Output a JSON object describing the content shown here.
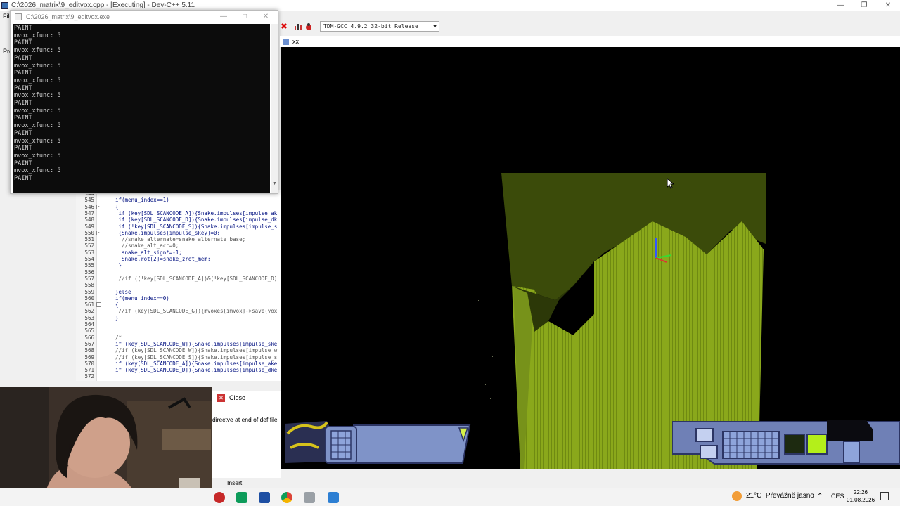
{
  "ide": {
    "title": "C:\\2026_matrix\\9_editvox.cpp - [Executing] - Dev-C++ 5.11",
    "menu_file": "File",
    "compiler": "TDM-GCC 4.9.2 32-bit Release",
    "project_tab": "Pro"
  },
  "console": {
    "title": "C:\\2026_matrix\\9_editvox.exe",
    "lines": [
      "PAINT",
      "mvox_xfunc: 5",
      "PAINT",
      "mvox_xfunc: 5",
      "PAINT",
      "mvox_xfunc: 5",
      "PAINT",
      "mvox_xfunc: 5",
      "PAINT",
      "mvox_xfunc: 5",
      "PAINT",
      "mvox_xfunc: 5",
      "PAINT",
      "mvox_xfunc: 5",
      "PAINT",
      "mvox_xfunc: 5",
      "PAINT",
      "mvox_xfunc: 5",
      "PAINT",
      "mvox_xfunc: 5",
      "PAINT"
    ]
  },
  "editor": {
    "lines": [
      {
        "n": "544",
        "t": ""
      },
      {
        "n": "545",
        "t": "if(menu_index==1)"
      },
      {
        "n": "546",
        "t": "{"
      },
      {
        "n": "547",
        "t": " if (key[SDL_SCANCODE_A]){Snake.impulses[impulse_ak"
      },
      {
        "n": "548",
        "t": " if (key[SDL_SCANCODE_D]){Snake.impulses[impulse_dk"
      },
      {
        "n": "549",
        "t": " if (!key[SDL_SCANCODE_S]){Snake.impulses[impulse_s"
      },
      {
        "n": "550",
        "t": " {Snake.impulses[impulse_skey]=0;"
      },
      {
        "n": "551",
        "t": "  //snake_alternate=snake_alternate_base;"
      },
      {
        "n": "552",
        "t": "  //snake_alt_acc=0;"
      },
      {
        "n": "553",
        "t": "  snake_alt_sign*=-1;"
      },
      {
        "n": "554",
        "t": "  Snake.rot[2]=snake_zrot_mem;"
      },
      {
        "n": "555",
        "t": " }"
      },
      {
        "n": "556",
        "t": ""
      },
      {
        "n": "557",
        "t": " //if ((!key[SDL_SCANCODE_A])&(!key[SDL_SCANCODE_D]"
      },
      {
        "n": "558",
        "t": ""
      },
      {
        "n": "559",
        "t": "}else"
      },
      {
        "n": "560",
        "t": "if(menu_index==0)"
      },
      {
        "n": "561",
        "t": "{"
      },
      {
        "n": "562",
        "t": " //if (key[SDL_SCANCODE_G]){mvoxes[imvox]->save(vox"
      },
      {
        "n": "563",
        "t": "}"
      },
      {
        "n": "564",
        "t": ""
      },
      {
        "n": "565",
        "t": ""
      },
      {
        "n": "566",
        "t": "/*"
      },
      {
        "n": "567",
        "t": "if (key[SDL_SCANCODE_W]){Snake.impulses[impulse_ske"
      },
      {
        "n": "568",
        "t": "//if (key[SDL_SCANCODE_W]){Snake.impulses[impulse_w"
      },
      {
        "n": "569",
        "t": "//if (key[SDL_SCANCODE_S]){Snake.impulses[impulse_s"
      },
      {
        "n": "570",
        "t": "if (key[SDL_SCANCODE_A]){Snake.impulses[impulse_ake"
      },
      {
        "n": "571",
        "t": "if (key[SDL_SCANCODE_D]){Snake.impulses[impulse_dke"
      },
      {
        "n": "572",
        "t": ""
      }
    ]
  },
  "messages": {
    "close_label": "Close",
    "text": "directve at end of def file"
  },
  "status": {
    "insert": "Insert"
  },
  "game": {
    "title": "xx"
  },
  "taskbar": {
    "temp": "21°C",
    "weather": "Převážně jasno",
    "lang": "CES",
    "time": "22:26",
    "date": "01.08.2026"
  },
  "colors": {
    "voxel_green": "#8fae1c",
    "hud_blue": "#7f93c8"
  }
}
